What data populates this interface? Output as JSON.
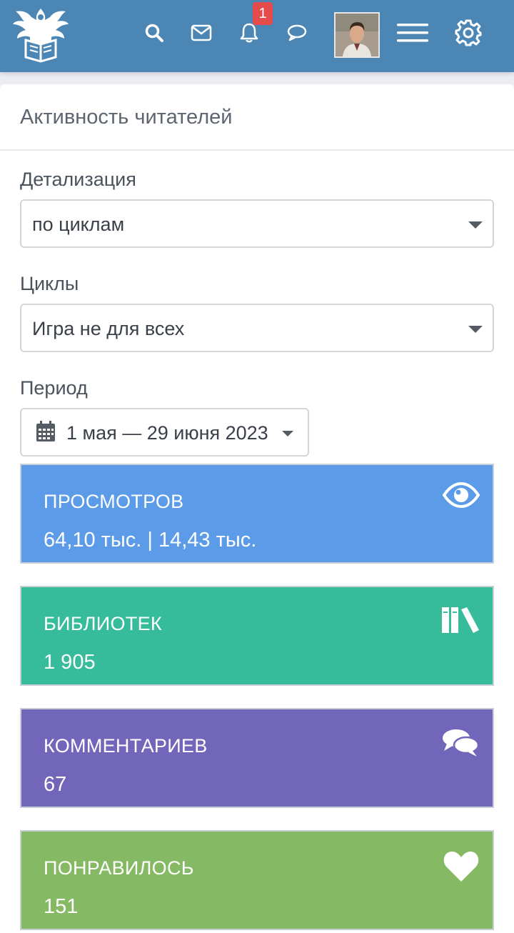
{
  "header": {
    "notification_count": "1",
    "icons": [
      "logo-eagle-book",
      "search-icon",
      "mail-icon",
      "bell-icon",
      "chat-icon",
      "menu-icon",
      "gear-icon"
    ],
    "bar_color": "#4b86b4"
  },
  "card": {
    "title": "Активность читателей"
  },
  "filters": {
    "detail_label": "Детализация",
    "detail_value": "по циклам",
    "cycles_label": "Циклы",
    "cycles_value": "Игра не для всех",
    "period_label": "Период",
    "period_value": "1 мая — 29 июня 2023"
  },
  "stats": [
    {
      "label": "ПРОСМОТРОВ",
      "value": "64,10 тыс. | 14,43 тыс.",
      "icon": "eye-icon",
      "color": "#5b9be7"
    },
    {
      "label": "БИБЛИОТЕК",
      "value": "1 905",
      "icon": "books-icon",
      "color": "#37bc9b"
    },
    {
      "label": "КОММЕНТАРИЕВ",
      "value": "67",
      "icon": "comments-icon",
      "color": "#7266ba"
    },
    {
      "label": "ПОНРАВИЛОСЬ",
      "value": "151",
      "icon": "heart-icon",
      "color": "#86b964"
    }
  ]
}
